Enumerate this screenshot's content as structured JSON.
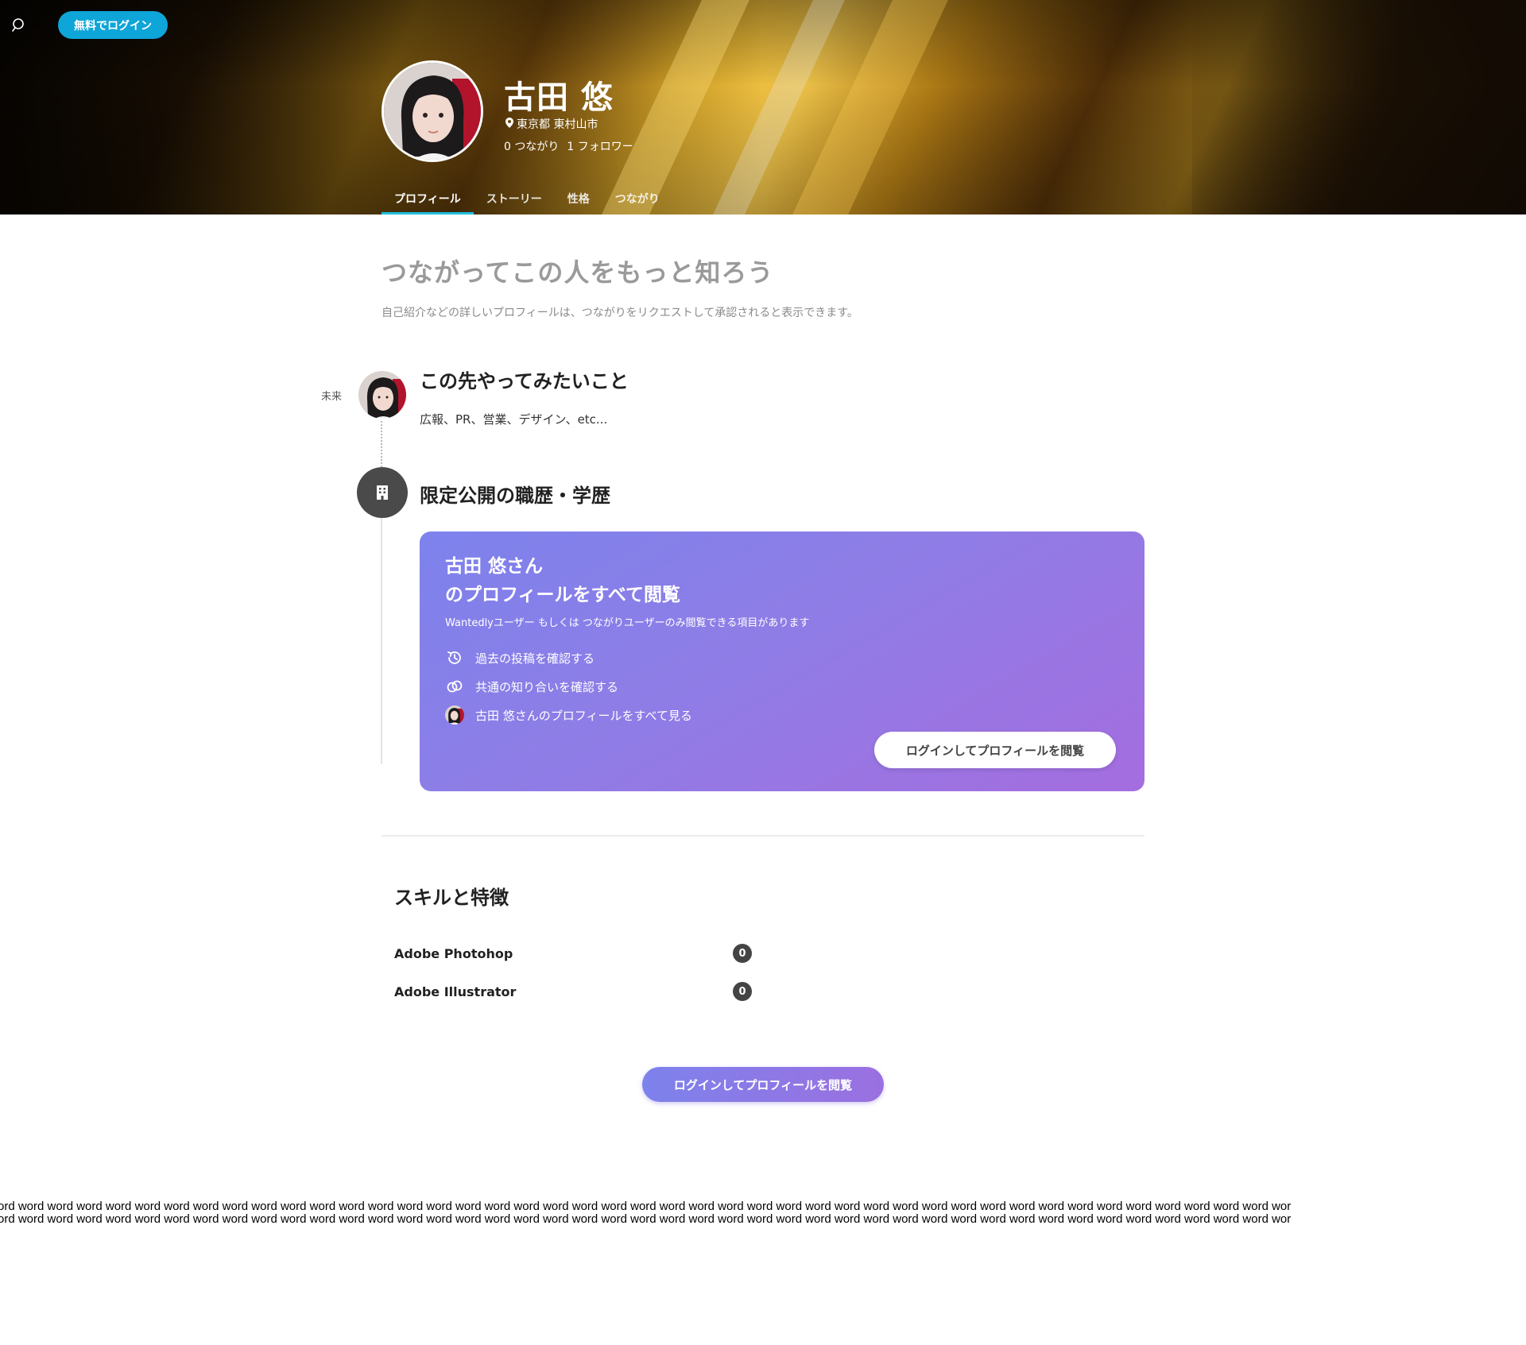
{
  "header": {
    "login_free_label": "無料でログイン",
    "search_icon": "search-icon"
  },
  "profile": {
    "name": "古田 悠",
    "location": "東京都 東村山市",
    "connections": "0 つながり",
    "followers": "1 フォロワー"
  },
  "tabs": [
    {
      "label": "プロフィール",
      "active": true
    },
    {
      "label": "ストーリー",
      "active": false
    },
    {
      "label": "性格",
      "active": false
    },
    {
      "label": "つながり",
      "active": false
    }
  ],
  "connect": {
    "title": "つながってこの人をもっと知ろう",
    "description": "自己紹介などの詳しいプロフィールは、つながりをリクエストして承認されると表示できます。"
  },
  "timeline": {
    "future_label": "未来",
    "future_title": "この先やってみたいこと",
    "future_text": "広報、PR、営業、デザイン、etc...",
    "career_title": "限定公開の職歴・学歴"
  },
  "promo": {
    "title_line1": "古田 悠さん",
    "title_line2": "のプロフィールをすべて閲覧",
    "subtitle": "Wantedlyユーザー もしくは つながりユーザーのみ閲覧できる項目があります",
    "items": [
      {
        "icon": "history-icon",
        "label": "過去の投稿を確認する"
      },
      {
        "icon": "link-icon",
        "label": "共通の知り合いを確認する"
      },
      {
        "icon": "avatar",
        "label": "古田 悠さんのプロフィールをすべて見る"
      }
    ],
    "button_label": "ログインしてプロフィールを閲覧"
  },
  "skills": {
    "title": "スキルと特徴",
    "items": [
      {
        "name": "Adobe Photohop",
        "count": "0"
      },
      {
        "name": "Adobe Illustrator",
        "count": "0"
      }
    ]
  },
  "bottom_button_label": "ログインしてプロフィールを閲覧",
  "word_strip": {
    "line1": "ord word word word word word word word word word word word word word word word word word word word word word word word word word word word word word word word word word word word word word word word word word word word wor",
    "line2": "ord word word word word word word word word word word word word word word word word word word word word word word word word word word word word word word word word word word word word word word word word word word word wor"
  },
  "colors": {
    "login_free_bg": "#0ea5d8",
    "tab_active_underline": "#21bddb",
    "promo_gradient_start": "#7d82ec",
    "promo_gradient_end": "#a46ddf"
  }
}
